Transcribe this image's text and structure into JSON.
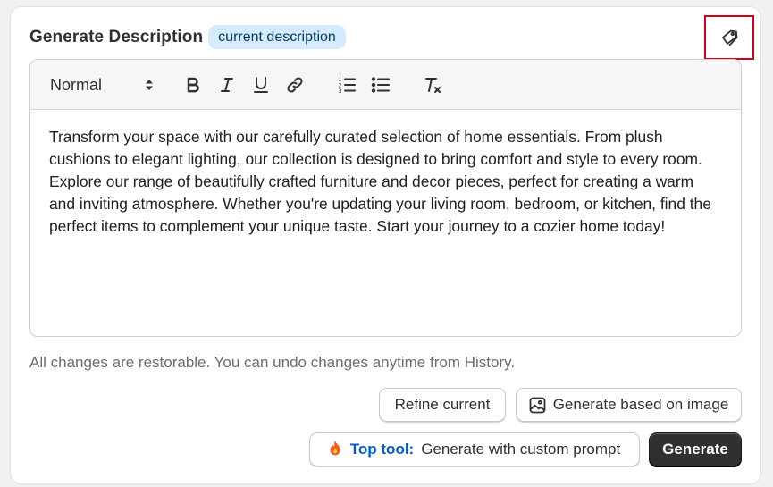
{
  "header": {
    "title": "Generate Description",
    "badge": "current description",
    "tag_icon": "tag-icon"
  },
  "toolbar": {
    "format_value": "Normal",
    "icons": [
      "bold-icon",
      "italic-icon",
      "underline-icon",
      "link-icon",
      "ordered-list-icon",
      "bullet-list-icon",
      "clear-format-icon"
    ]
  },
  "editor": {
    "content": "Transform your space with our carefully curated selection of home essentials. From plush cushions to elegant lighting, our collection is designed to bring comfort and style to every room. Explore our range of beautifully crafted furniture and decor pieces, perfect for creating a warm and inviting atmosphere. Whether you're updating your living room, bedroom, or kitchen, find the perfect items to complement your unique taste. Start your journey to a cozier home today!"
  },
  "helper_text": "All changes are restorable. You can undo changes anytime from History.",
  "actions": {
    "refine_label": "Refine current",
    "image_label": "Generate based on image",
    "top_tool_label": "Top tool:",
    "custom_prompt_label": "Generate with custom prompt",
    "generate_label": "Generate"
  },
  "colors": {
    "badge_bg": "#d5ebff",
    "accent_blue": "#005bd3",
    "highlight_border": "#d0021b",
    "primary_button": "#303030"
  }
}
